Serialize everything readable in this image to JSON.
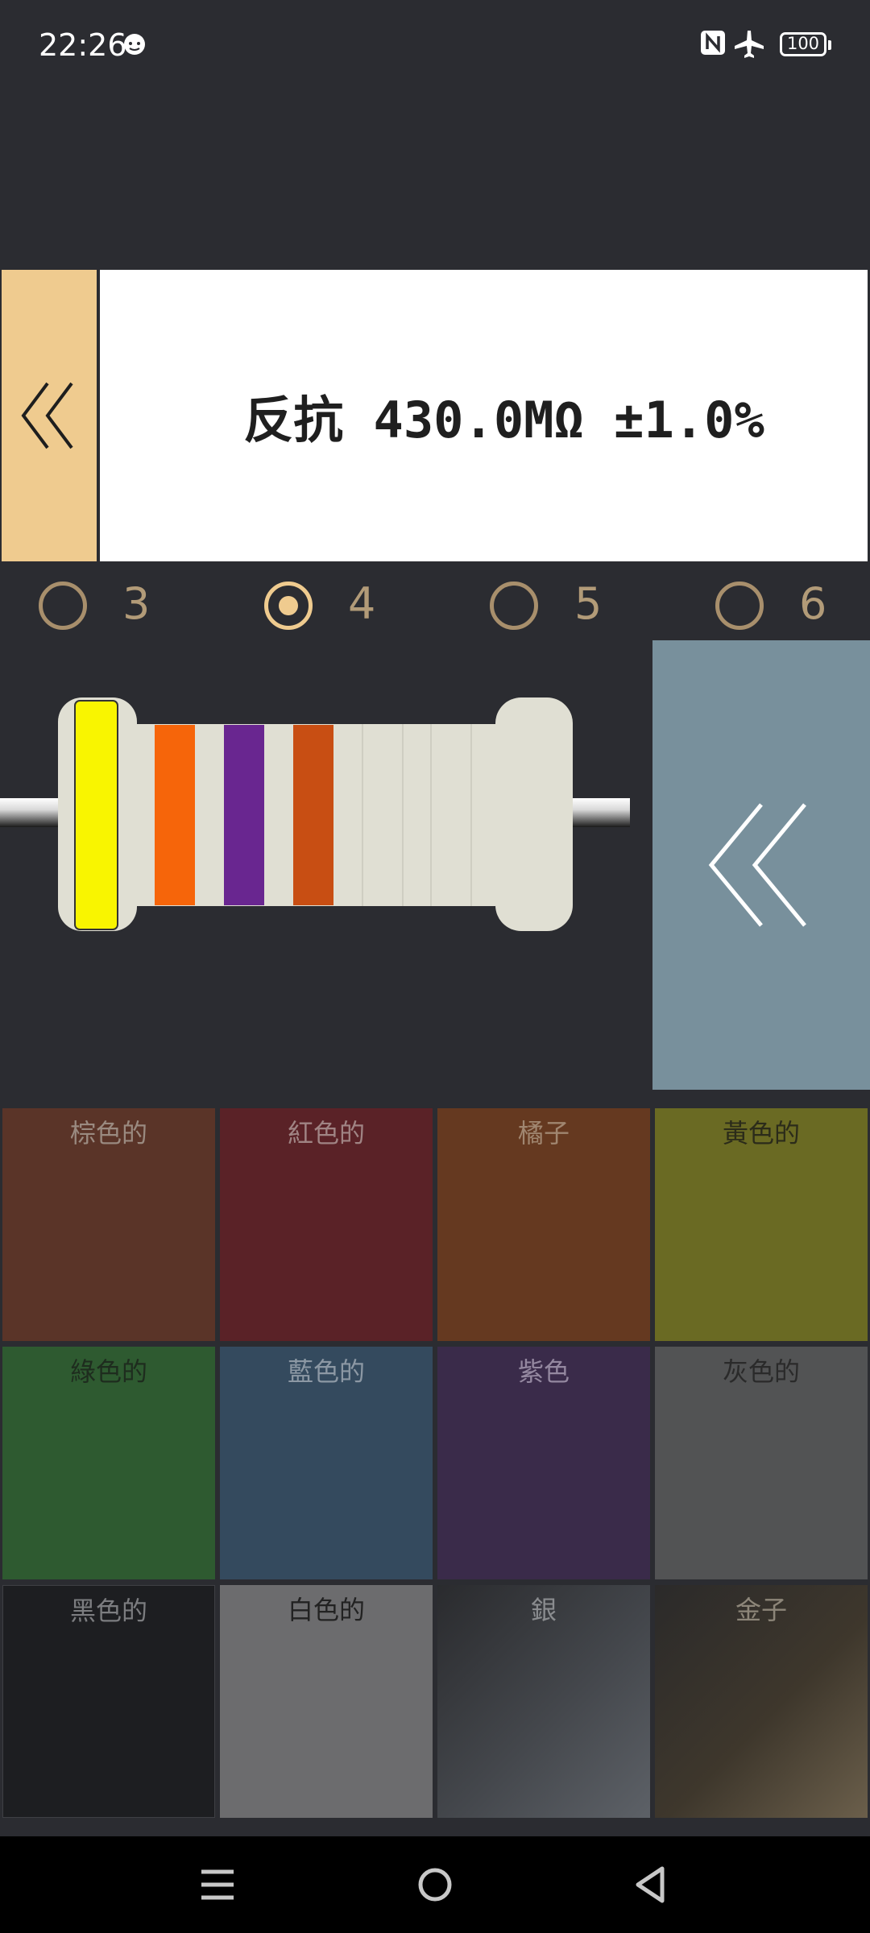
{
  "status_bar": {
    "time": "22:26",
    "icons": [
      "face-icon",
      "nfc-icon",
      "airplane-icon",
      "battery-icon"
    ],
    "battery": "100"
  },
  "result": {
    "text": "反抗 430.0MΩ ±1.0%"
  },
  "band_options": [
    {
      "label": "3",
      "selected": false
    },
    {
      "label": "4",
      "selected": true
    },
    {
      "label": "5",
      "selected": false
    },
    {
      "label": "6",
      "selected": false
    }
  ],
  "resistor": {
    "bands": [
      "#f9f500",
      "#f6650a",
      "#692690",
      "#c84e13"
    ]
  },
  "colors": [
    {
      "label": "棕色的",
      "bg": "#5a3428",
      "fg": "#9a8a80"
    },
    {
      "label": "紅色的",
      "bg": "#5a2227",
      "fg": "#a08484"
    },
    {
      "label": "橘子",
      "bg": "#653920",
      "fg": "#a08670"
    },
    {
      "label": "黃色的",
      "bg": "#6a6a23",
      "fg": "#2b2b1a"
    },
    {
      "label": "綠色的",
      "bg": "#2e5a30",
      "fg": "#1e2c1e"
    },
    {
      "label": "藍色的",
      "bg": "#344a5e",
      "fg": "#8c98a4"
    },
    {
      "label": "紫色",
      "bg": "#3a2b4a",
      "fg": "#9488a0"
    },
    {
      "label": "灰色的",
      "bg": "#525354",
      "fg": "#2a2a2a"
    },
    {
      "label": "黑色的",
      "bg": "#1d1e21",
      "fg": "#7c7d80"
    },
    {
      "label": "白色的",
      "bg": "#6c6c6e",
      "fg": "#222"
    },
    {
      "label": "銀",
      "bg": "#3b3e42",
      "fg": "#8a8c8f"
    },
    {
      "label": "金子",
      "bg": "#3e372c",
      "fg": "#8d8679"
    }
  ]
}
